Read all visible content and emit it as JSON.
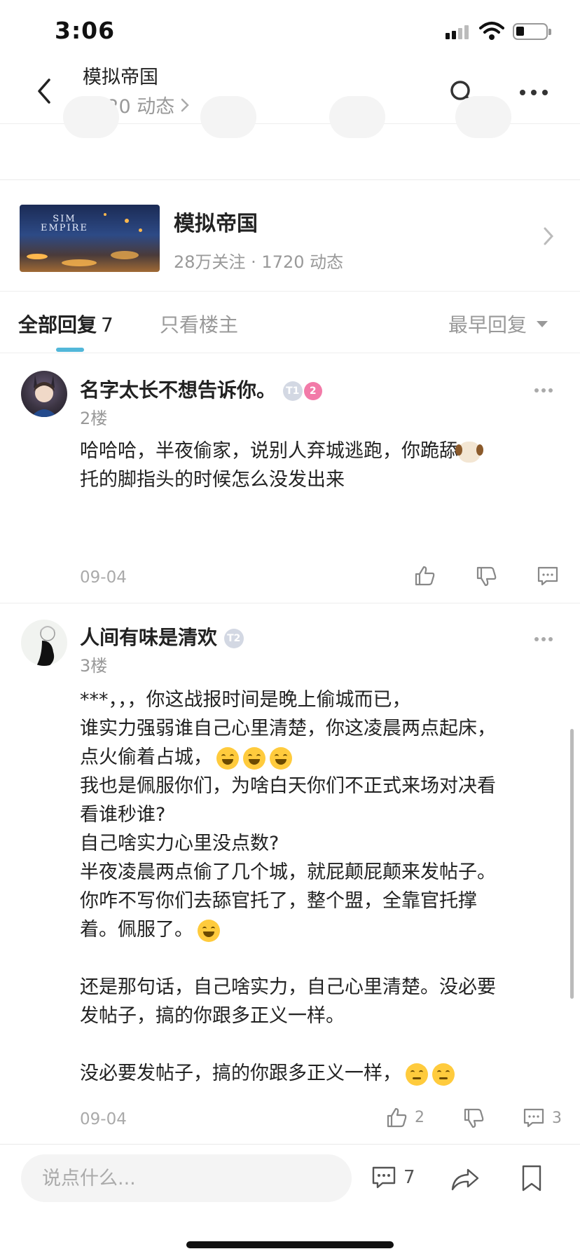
{
  "status_bar": {
    "time": "3:06"
  },
  "header": {
    "title": "模拟帝国",
    "subtitle": "1720 动态"
  },
  "forum": {
    "name": "模拟帝国",
    "stats": "28万关注 · 1720 动态",
    "image_text": [
      "SIM",
      "EMPIRE"
    ]
  },
  "tabs": {
    "all_label": "全部回复",
    "all_count": "7",
    "owner_only": "只看楼主",
    "sort_label": "最早回复"
  },
  "replies": [
    {
      "username": "名字太长不想告诉你。",
      "badges": [
        "T1",
        "2"
      ],
      "floor": "2楼",
      "text_1": "哈哈哈，半夜偷家，说别人弃城逃跑，你跪舔",
      "text_2": "托的脚指头的时候怎么没发出来",
      "date": "09-04",
      "likes": "",
      "replies_count": ""
    },
    {
      "username": "人间有味是清欢",
      "badges": [
        "T2"
      ],
      "floor": "3楼",
      "text_1": "***，，，你这战报时间是晚上偷城而已，\n谁实力强弱谁自己心里清楚，你这凌晨两点起床，\n点火偷着占城，",
      "text_2": "我也是佩服你们，为啥白天你们不正式来场对决看\n看谁秒谁?\n自己啥实力心里没点数?\n半夜凌晨两点偷了几个城，就屁颠屁颠来发帖子。\n你咋不写你们去舔官托了，整个盟，全靠官托撑\n着。佩服了。",
      "text_3": "还是那句话，自己啥实力，自己心里清楚。没必要\n发帖子，搞的你跟多正义一样。",
      "text_4": "没必要发帖子，搞的你跟多正义一样，",
      "date": "09-04",
      "likes": "2",
      "replies_count": "3"
    }
  ],
  "bottom_bar": {
    "input_placeholder": "说点什么...",
    "comment_count": "7"
  },
  "colors": {
    "accent": "#52b7d9",
    "badge_pink": "#f27aa8",
    "muted": "#999999"
  },
  "icons": [
    "back-icon",
    "search-icon",
    "more-icon",
    "chevron-right-icon",
    "caret-down-icon",
    "thumbs-up-icon",
    "thumbs-down-icon",
    "comment-icon",
    "share-icon",
    "bookmark-icon"
  ]
}
